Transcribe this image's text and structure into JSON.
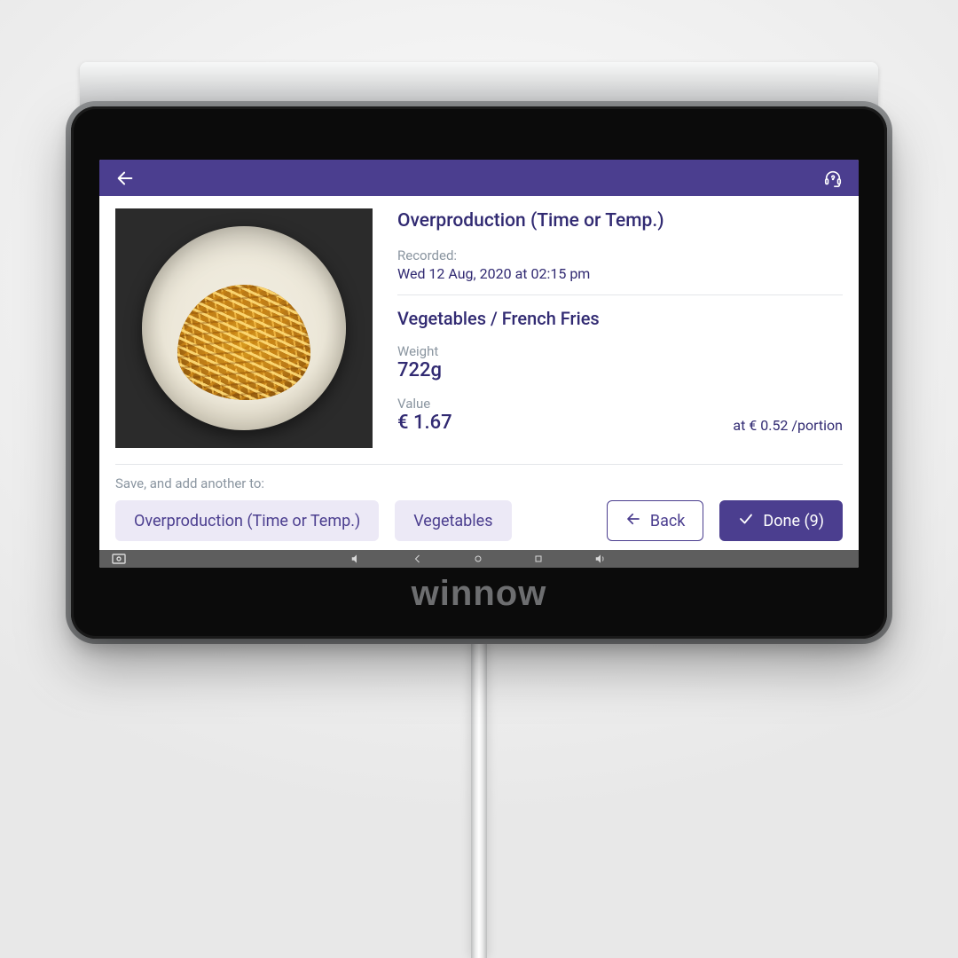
{
  "brand": "winnow",
  "header": {
    "back_icon": "back-arrow-icon",
    "help_icon": "headset-help-icon"
  },
  "record": {
    "category_title": "Overproduction (Time or Temp.)",
    "recorded_label": "Recorded:",
    "recorded_value": "Wed 12 Aug, 2020 at 02:15 pm",
    "item_path": "Vegetables / French Fries",
    "weight_label": "Weight",
    "weight_value": "722g",
    "value_label": "Value",
    "value_amount": "€ 1.67",
    "portion_rate": "at € 0.52 /portion"
  },
  "actions": {
    "save_prompt": "Save, and add another to:",
    "quick_add_1": "Overproduction (Time or Temp.)",
    "quick_add_2": "Vegetables",
    "back_label": "Back",
    "done_label": "Done (9)"
  }
}
